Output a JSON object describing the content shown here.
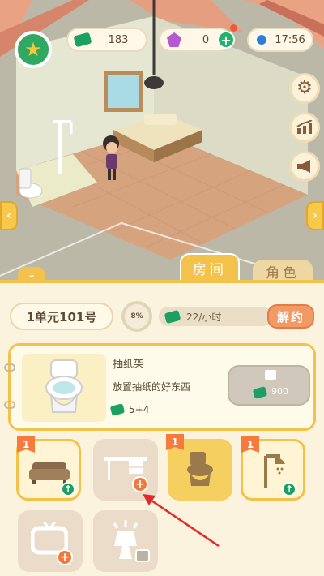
{
  "hud": {
    "cash": "183",
    "gems": "0",
    "time": "17:56"
  },
  "tabs": {
    "room": "房间",
    "character": "角色"
  },
  "room_info": {
    "name": "1单元101号",
    "progress_percent": "8%",
    "rate": "22/小时",
    "terminate_label": "解约"
  },
  "selected_item": {
    "name": "抽纸架",
    "description": "放置抽纸的好东西",
    "reward": "5+4",
    "price": "900"
  },
  "item_slots": [
    {
      "badge": "1",
      "icon": "sofa-icon",
      "state": "upgrade"
    },
    {
      "badge": "",
      "icon": "desk-icon",
      "state": "add"
    },
    {
      "badge": "1",
      "icon": "toilet-icon",
      "state": "selected"
    },
    {
      "badge": "1",
      "icon": "shower-icon",
      "state": "upgrade"
    },
    {
      "badge": "",
      "icon": "tv-icon",
      "state": "add"
    },
    {
      "badge": "",
      "icon": "lamp-icon",
      "state": "locked"
    }
  ],
  "colors": {
    "accent_yellow": "#f2c24a",
    "cash_green": "#1aa061",
    "badge_orange": "#f47b3d",
    "text_brown": "#5a4a36",
    "annotation_red": "#e02a2a"
  }
}
